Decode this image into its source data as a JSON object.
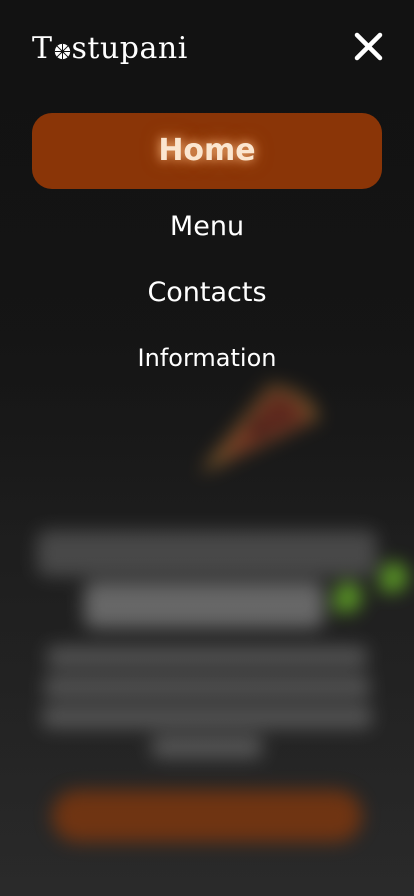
{
  "brand": {
    "name_prefix": "T",
    "name_suffix": "stupani",
    "logo_icon": "pizza-icon"
  },
  "header": {
    "close_icon": "close-icon"
  },
  "nav": {
    "items": [
      {
        "label": "Home",
        "active": true
      },
      {
        "label": "Menu",
        "active": false
      },
      {
        "label": "Contacts",
        "active": false
      },
      {
        "label": "Information",
        "active": false
      }
    ]
  },
  "colors": {
    "accent": "#8a3507",
    "background": "#1b1b1b",
    "text": "#ffffff",
    "active_text": "#fbe6d0",
    "leaf_green": "#6bb62a"
  }
}
